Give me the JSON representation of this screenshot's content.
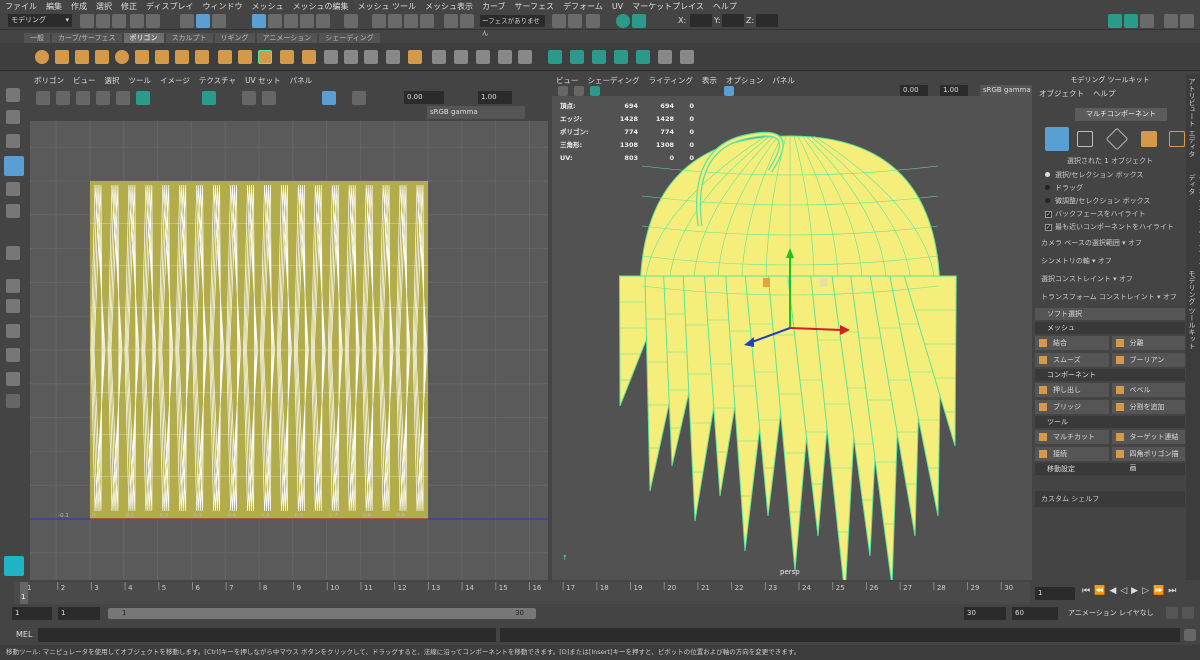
{
  "menubar": [
    "ファイル",
    "編集",
    "作成",
    "選択",
    "修正",
    "ディスプレイ",
    "ウィンドウ",
    "メッシュ",
    "メッシュの編集",
    "メッシュ ツール",
    "メッシュ表示",
    "カーブ",
    "サーフェス",
    "デフォーム",
    "UV",
    "マーケットプレイス",
    "ヘルプ"
  ],
  "status": {
    "mode": "モデリング",
    "no_face": "ーフェスがありません",
    "x_label": "X:",
    "y_label": "Y:",
    "z_label": "Z:"
  },
  "shelf_tabs": [
    "一般",
    "カーブ/サーフェス",
    "ポリゴン",
    "スカルプト",
    "リギング",
    "アニメーション",
    "シェーディング"
  ],
  "uv_panel": {
    "menu": [
      "ポリゴン",
      "ビュー",
      "選択",
      "ツール",
      "イメージ",
      "テクスチャ",
      "UV セット",
      "パネル"
    ],
    "val1": "0.00",
    "val2": "1.00",
    "gamma": "sRGB gamma",
    "tick_labels": [
      "-0.1",
      "0",
      "0.1",
      "0.2",
      "0.3",
      "0.4",
      "0.5",
      "0.6",
      "0.7",
      "0.8",
      "0.9"
    ]
  },
  "persp_panel": {
    "menu": [
      "ビュー",
      "シェーディング",
      "ライティング",
      "表示",
      "オプション",
      "パネル"
    ],
    "val1": "0.00",
    "val2": "1.00",
    "gamma": "sRGB gamma",
    "camera": "persp",
    "hud": [
      [
        "頂点:",
        "694",
        "694",
        "0"
      ],
      [
        "エッジ:",
        "1428",
        "1428",
        "0"
      ],
      [
        "ポリゴン:",
        "774",
        "774",
        "0"
      ],
      [
        "三角形:",
        "1308",
        "1308",
        "0"
      ],
      [
        "UV:",
        "803",
        "0",
        "0"
      ]
    ]
  },
  "toolkit": {
    "title": "モデリング ツールキット",
    "menu": [
      "オブジェクト",
      "ヘルプ"
    ],
    "multi": "マルチコンポーネント",
    "selected": "選択された 1 オブジェクト",
    "radios": [
      "選択/セレクション ボックス",
      "ドラッグ",
      "微調整/セレクション ボックス"
    ],
    "checks": [
      "バックフェースをハイライト",
      "最も近いコンポーネントをハイライト"
    ],
    "camera_based": "カメラ ベースの選択範囲",
    "symmetry": "シンメトリの軸",
    "sel_constraint": "選択コンストレイント",
    "xf_constraint": "トランスフォーム コンストレイント",
    "off": "オフ",
    "soft": "ソフト選択",
    "sec_mesh": "メッシュ",
    "mesh_btns": [
      "結合",
      "分離",
      "スムーズ",
      "ブーリアン"
    ],
    "sec_comp": "コンポーネント",
    "comp_btns": [
      "押し出し",
      "ベベル",
      "ブリッジ",
      "分割を追加"
    ],
    "sec_tool": "ツール",
    "tool_btns": [
      "マルチカット",
      "ターゲット連結",
      "接続",
      "四角ポリゴン描画"
    ],
    "sec_move": "移動設定",
    "custom_shelf": "カスタム シェルフ"
  },
  "vtabs": [
    "アトリビュート エディタ",
    "チャネル ボックス/レイヤ エディタ",
    "モデリング ツールキット"
  ],
  "timeline": {
    "ticks": [
      "1",
      "2",
      "3",
      "4",
      "5",
      "6",
      "7",
      "8",
      "9",
      "10",
      "11",
      "12",
      "13",
      "14",
      "15",
      "16",
      "17",
      "18",
      "19",
      "20",
      "21",
      "22",
      "23",
      "24",
      "25",
      "26",
      "27",
      "28",
      "29",
      "30"
    ],
    "current": "1",
    "right_field": "1"
  },
  "range": {
    "start": "1",
    "start2": "1",
    "range_start": "1",
    "range_end": "30",
    "end": "30",
    "end2": "60",
    "anim_layer": "アニメーション レイヤなし"
  },
  "cmd": {
    "label": "MEL"
  },
  "help": "移動ツール: マニピュレータを使用してオブジェクトを移動します。[Ctrl]キーを押しながら中マウス ボタンをクリックして、ドラッグすると、法線に沿ってコンポーネントを移動できます。[D]または[Insert]キーを押すと、ピボットの位置および軸の方向を変更できます。",
  "colors": {
    "bg": "#444444",
    "uv_fill": "#b3ac4a",
    "mesh_fill": "#f5ee7a",
    "wire": "#5de39a",
    "accent": "#5a9fd4"
  }
}
